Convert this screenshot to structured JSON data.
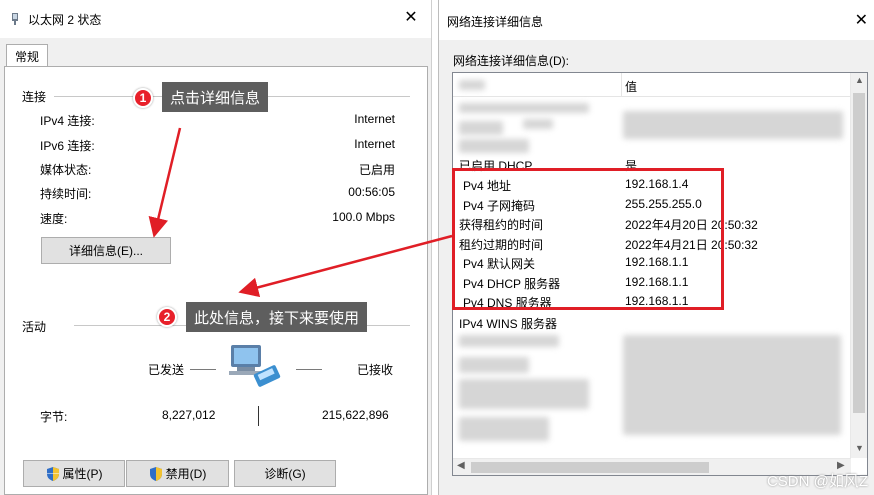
{
  "left_window": {
    "title": "以太网 2 状态",
    "tab": "常规",
    "connection": {
      "group_label": "连接",
      "rows": [
        {
          "label": "IPv4 连接:",
          "value": "Internet"
        },
        {
          "label": "IPv6 连接:",
          "value": "Internet"
        },
        {
          "label": "媒体状态:",
          "value": "已启用"
        },
        {
          "label": "持续时间:",
          "value": "00:56:05"
        },
        {
          "label": "速度:",
          "value": "100.0 Mbps"
        }
      ],
      "details_button": "详细信息(E)..."
    },
    "activity": {
      "group_label": "活动",
      "sent_label": "已发送",
      "received_label": "已接收",
      "bytes_label": "字节:",
      "bytes_sent": "8,227,012",
      "bytes_received": "215,622,896"
    },
    "buttons": {
      "properties": "属性(P)",
      "disable": "禁用(D)",
      "diagnose": "诊断(G)"
    }
  },
  "callouts": {
    "step1_number": "1",
    "step1_text": "点击详细信息",
    "step2_number": "2",
    "step2_text": "此处信息，接下来要使用"
  },
  "right_window": {
    "title": "网络连接详细信息",
    "caption": "网络连接详细信息(D):",
    "columns": {
      "value": "值"
    },
    "rows": [
      {
        "property": "已启用 DHCP",
        "value": "是"
      },
      {
        "property": "Pv4 地址",
        "value": "192.168.1.4"
      },
      {
        "property": "Pv4 子网掩码",
        "value": "255.255.255.0"
      },
      {
        "property": "获得租约的时间",
        "value": "2022年4月20日 20:50:32"
      },
      {
        "property": "租约过期的时间",
        "value": "2022年4月21日 20:50:32"
      },
      {
        "property": "Pv4 默认网关",
        "value": "192.168.1.1"
      },
      {
        "property": "Pv4 DHCP 服务器",
        "value": "192.168.1.1"
      },
      {
        "property": "Pv4 DNS 服务器",
        "value": "192.168.1.1"
      },
      {
        "property": "IPv4 WINS 服务器",
        "value": ""
      }
    ]
  },
  "watermark": "CSDN @如风Z",
  "colors": {
    "accent_red": "#e01e26",
    "tip_bg": "#5e5e5e"
  }
}
